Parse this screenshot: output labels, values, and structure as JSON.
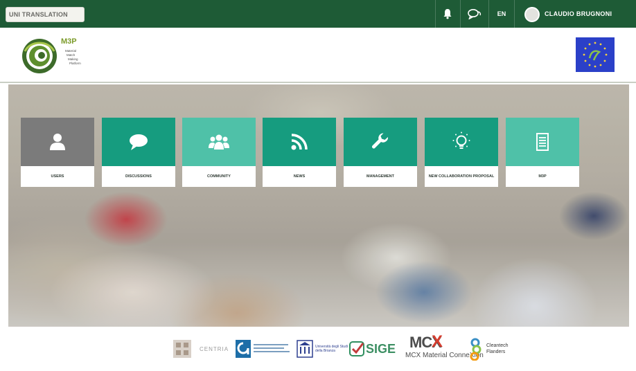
{
  "topbar": {
    "translate_label": "UNI TRANSLATION",
    "language": "EN",
    "user_name": "CLAUDIO BRUGNONI",
    "icons": [
      "bell-icon",
      "chat-icon"
    ]
  },
  "header": {
    "logo_brand": "M3P",
    "logo_lines": [
      "Material",
      "Match",
      "Making",
      "Platform"
    ]
  },
  "tiles": [
    {
      "label": "USERS",
      "color": "#7b7b7b",
      "icon": "user-icon"
    },
    {
      "label": "DISCUSSIONS",
      "color": "#169c7f",
      "icon": "speech-bubble-icon"
    },
    {
      "label": "COMMUNITY",
      "color": "#4fc1a8",
      "icon": "group-icon"
    },
    {
      "label": "NEWS",
      "color": "#169c7f",
      "icon": "rss-icon"
    },
    {
      "label": "MANAGEMENT",
      "color": "#169c7f",
      "icon": "wrench-icon"
    },
    {
      "label": "NEW COLLABORATION PROPOSAL",
      "color": "#169c7f",
      "icon": "lightbulb-icon"
    },
    {
      "label": "M3P",
      "color": "#4fc1a8",
      "icon": "document-icon"
    }
  ],
  "footer": {
    "partners": [
      "CENTRIA",
      "Università degli Studi della Brianza",
      "SIGE",
      "MCX Material ConneXion",
      "Cleantech Flanders"
    ]
  },
  "colors": {
    "topbar": "#1e5b36",
    "teal_dark": "#169c7f",
    "teal_light": "#4fc1a8",
    "grey_tile": "#7b7b7b"
  }
}
